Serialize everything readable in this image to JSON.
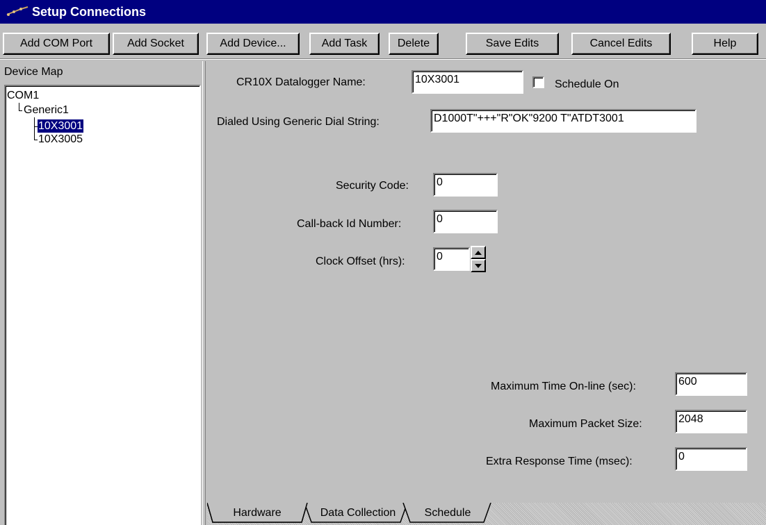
{
  "window": {
    "title": "Setup Connections"
  },
  "toolbar": {
    "add_com_port": "Add COM Port",
    "add_socket": "Add Socket",
    "add_device": "Add Device...",
    "add_task": "Add Task",
    "delete": "Delete",
    "save_edits": "Save Edits",
    "cancel_edits": "Cancel Edits",
    "help": "Help"
  },
  "device_map": {
    "label": "Device Map",
    "nodes": [
      "COM1",
      "Generic1",
      "10X3001",
      "10X3005"
    ],
    "selected": "10X3001"
  },
  "form": {
    "datalogger_name_label": "CR10X Datalogger Name:",
    "datalogger_name_value": "10X3001",
    "schedule_on_label": "Schedule On",
    "schedule_on_checked": false,
    "dial_string_label": "Dialed Using Generic Dial String:",
    "dial_string_value": "D1000T\"+++\"R\"OK\"9200 T\"ATDT3001",
    "security_code_label": "Security Code:",
    "security_code_value": "0",
    "callback_label": "Call-back Id Number:",
    "callback_value": "0",
    "clock_offset_label": "Clock Offset (hrs):",
    "clock_offset_value": "0",
    "max_time_label": "Maximum Time On-line (sec):",
    "max_time_value": "600",
    "max_packet_label": "Maximum Packet Size:",
    "max_packet_value": "2048",
    "extra_response_label": "Extra Response Time (msec):",
    "extra_response_value": "0"
  },
  "tabs": [
    "Hardware",
    "Data Collection",
    "Schedule"
  ],
  "active_tab": "Hardware",
  "colors": {
    "titlebar": "#000080",
    "face": "#c0c0c0",
    "selection": "#000080"
  }
}
